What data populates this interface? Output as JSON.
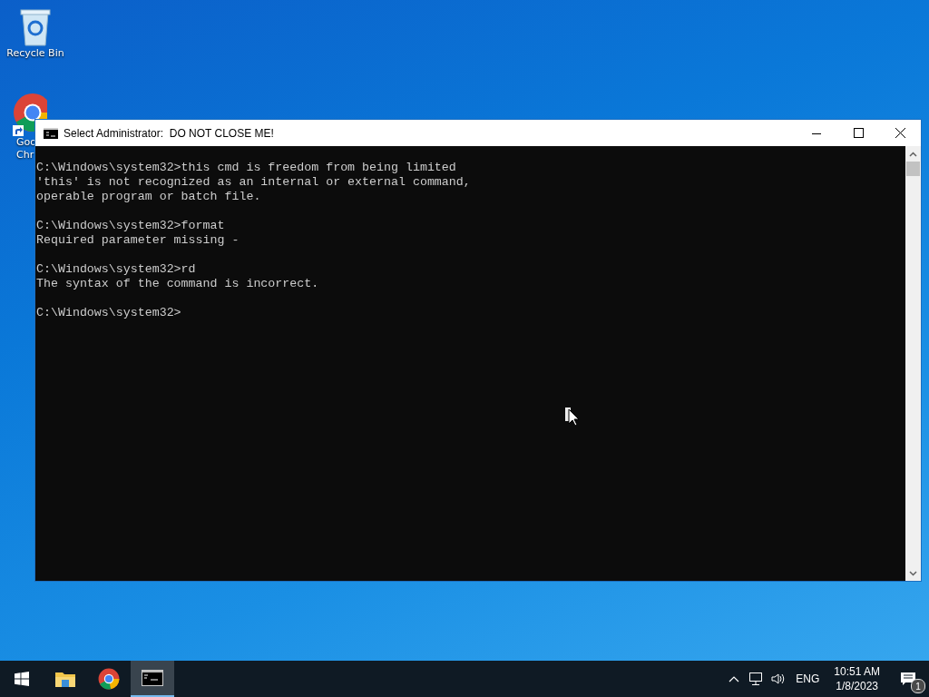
{
  "desktop_icons": [
    {
      "kind": "recycle",
      "lines": [
        "Recycle Bin"
      ]
    },
    {
      "kind": "chrome",
      "lines": [
        "Goo",
        "Chr"
      ]
    }
  ],
  "window": {
    "title": "Select Administrator:  DO NOT CLOSE ME!",
    "console_blocks": [
      [
        "C:\\Windows\\system32>this cmd is freedom from being limited",
        "'this' is not recognized as an internal or external command,",
        "operable program or batch file."
      ],
      [
        "C:\\Windows\\system32>format",
        "Required parameter missing -"
      ],
      [
        "C:\\Windows\\system32>rd",
        "The syntax of the command is incorrect."
      ],
      [
        "C:\\Windows\\system32>"
      ]
    ]
  },
  "taskbar": {
    "apps": [
      {
        "kind": "explorer",
        "selected": false
      },
      {
        "kind": "chrome",
        "selected": false
      },
      {
        "kind": "cmd",
        "selected": true
      }
    ],
    "tray": {
      "language": "ENG",
      "time": "10:51 AM",
      "date": "1/8/2023",
      "notification_count": "1"
    }
  }
}
